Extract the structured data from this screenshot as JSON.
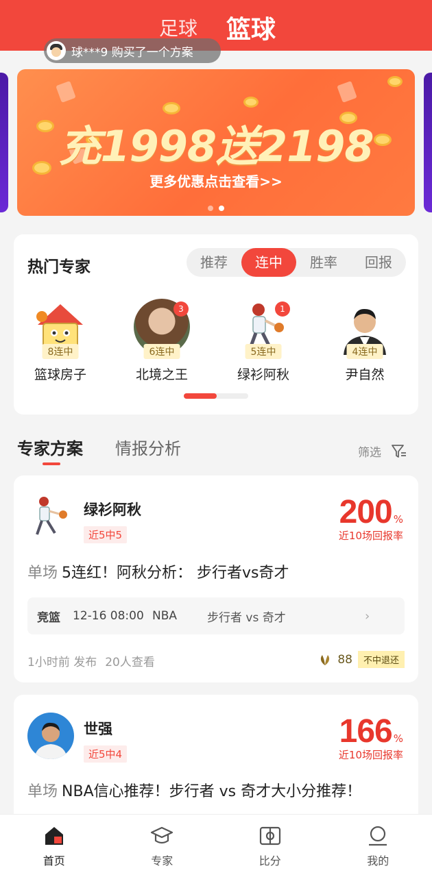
{
  "header": {
    "tab_football": "足球",
    "tab_basketball": "篮球"
  },
  "notice": {
    "text": "球***9 购买了一个方案"
  },
  "banner": {
    "title": "充1998送2198",
    "subtitle": "更多优惠点击查看>>"
  },
  "hot": {
    "title": "热门专家",
    "segments": [
      "推荐",
      "连中",
      "胜率",
      "回报"
    ],
    "experts": [
      {
        "name": "篮球房子",
        "streak": "8连中",
        "badge": ""
      },
      {
        "name": "北境之王",
        "streak": "6连中",
        "badge": "3"
      },
      {
        "name": "绿衫阿秋",
        "streak": "5连中",
        "badge": "1"
      },
      {
        "name": "尹自然",
        "streak": "4连中",
        "badge": ""
      }
    ]
  },
  "tabs": {
    "plans": "专家方案",
    "intel": "情报分析",
    "filter": "筛选"
  },
  "plans": [
    {
      "name": "绿衫阿秋",
      "tag": "近5中5",
      "rate": "200",
      "rate_unit": "%",
      "rate_label": "近10场回报率",
      "kind": "单场",
      "headline": "5连红！阿秋分析： 步行者vs奇才",
      "match": {
        "lg": "竞篮",
        "time": "12-16 08:00",
        "league": "NBA",
        "vs": "步行者 vs 奇才"
      },
      "published": "1小时前 发布",
      "views": "20人查看",
      "price": "88",
      "refund": "不中退还"
    },
    {
      "name": "世强",
      "tag": "近5中4",
      "rate": "166",
      "rate_unit": "%",
      "rate_label": "近10场回报率",
      "kind": "单场",
      "headline": "NBA信心推荐！步行者 vs 奇才大小分推荐！"
    }
  ],
  "nav": {
    "home": "首页",
    "expert": "专家",
    "score": "比分",
    "mine": "我的"
  },
  "colors": {
    "accent": "#f2473c",
    "banner": "#ff7a40"
  }
}
